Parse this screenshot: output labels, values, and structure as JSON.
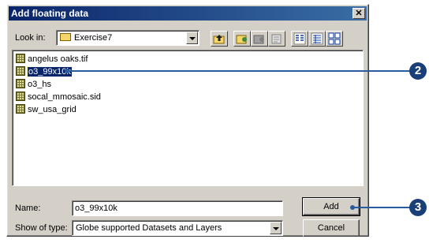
{
  "dialog": {
    "title": "Add floating data",
    "close_glyph": "✕"
  },
  "look_in": {
    "label": "Look in:",
    "value": "Exercise7"
  },
  "toolbar": {
    "icons": [
      "up-one-level-icon",
      "connect-folder-icon",
      "disconnect-folder-icon",
      "new-folder-icon",
      "list-view-icon",
      "details-view-icon",
      "thumbnail-view-icon"
    ]
  },
  "files": [
    {
      "name": "angelus oaks.tif",
      "selected": false
    },
    {
      "name": "o3_99x10k",
      "selected": true
    },
    {
      "name": "o3_hs",
      "selected": false
    },
    {
      "name": "socal_mmosaic.sid",
      "selected": false
    },
    {
      "name": "sw_usa_grid",
      "selected": false
    }
  ],
  "name_field": {
    "label": "Name:",
    "value": "o3_99x10k"
  },
  "type_field": {
    "label": "Show of type:",
    "value": "Globe supported Datasets and Layers"
  },
  "buttons": {
    "add": "Add",
    "cancel": "Cancel"
  },
  "callouts": {
    "step2": "2",
    "step3": "3"
  },
  "colors": {
    "title_bar": "#0a246a",
    "selection": "#0a246a",
    "callout": "#1a3f78",
    "dialog_face": "#d4d0c8"
  }
}
